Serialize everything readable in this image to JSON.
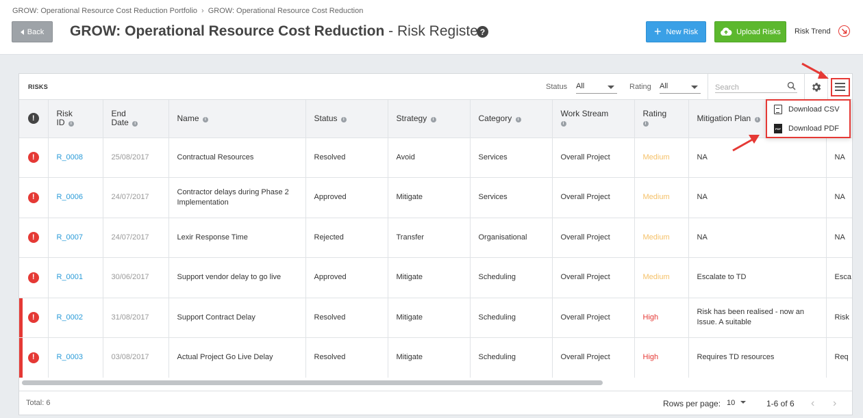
{
  "breadcrumb": [
    "GROW: Operational Resource Cost Reduction Portfolio",
    "GROW: Operational Resource Cost Reduction"
  ],
  "header": {
    "back_label": "Back",
    "title_bold": "GROW: Operational Resource Cost Reduction",
    "title_rest": " - Risk Register",
    "help": "?",
    "new_risk_label": "New Risk",
    "upload_risks_label": "Upload Risks",
    "risk_trend_label": "Risk Trend"
  },
  "toolbar": {
    "section_label": "RISKS",
    "status_label": "Status",
    "status_value": "All",
    "rating_label": "Rating",
    "rating_value": "All",
    "search_placeholder": "Search"
  },
  "dropdown": {
    "csv_label": "Download CSV",
    "pdf_label": "Download PDF",
    "pdf_icon_text": "PDF"
  },
  "table": {
    "headers": {
      "risk_id_1": "Risk",
      "risk_id_2": "ID",
      "end_date_1": "End",
      "end_date_2": "Date",
      "name": "Name",
      "status": "Status",
      "strategy": "Strategy",
      "category": "Category",
      "work_stream": "Work Stream",
      "rating": "Rating",
      "mitigation_plan": "Mitigation Plan"
    },
    "rows": [
      {
        "id": "R_0008",
        "end_date": "25/08/2017",
        "name": "Contractual Resources",
        "status": "Resolved",
        "strategy": "Avoid",
        "category": "Services",
        "work_stream": "Overall Project",
        "rating": "Medium",
        "mitigation": "NA",
        "extra": "NA",
        "flagged": false
      },
      {
        "id": "R_0006",
        "end_date": "24/07/2017",
        "name": "Contractor delays during Phase 2 Implementation",
        "status": "Approved",
        "strategy": "Mitigate",
        "category": "Services",
        "work_stream": "Overall Project",
        "rating": "Medium",
        "mitigation": "NA",
        "extra": "NA",
        "flagged": false
      },
      {
        "id": "R_0007",
        "end_date": "24/07/2017",
        "name": "Lexir Response Time",
        "status": "Rejected",
        "strategy": "Transfer",
        "category": "Organisational",
        "work_stream": "Overall Project",
        "rating": "Medium",
        "mitigation": "NA",
        "extra": "NA",
        "flagged": false
      },
      {
        "id": "R_0001",
        "end_date": "30/06/2017",
        "name": "Support vendor delay to go live",
        "status": "Approved",
        "strategy": "Mitigate",
        "category": "Scheduling",
        "work_stream": "Overall Project",
        "rating": "Medium",
        "mitigation": "Escalate to TD",
        "extra": "Esca",
        "flagged": false
      },
      {
        "id": "R_0002",
        "end_date": "31/08/2017",
        "name": "Support Contract Delay",
        "status": "Resolved",
        "strategy": "Mitigate",
        "category": "Scheduling",
        "work_stream": "Overall Project",
        "rating": "High",
        "mitigation": "Risk has been realised - now an Issue. A suitable",
        "extra": "Risk Issu",
        "flagged": true
      },
      {
        "id": "R_0003",
        "end_date": "03/08/2017",
        "name": "Actual Project Go Live Delay",
        "status": "Resolved",
        "strategy": "Mitigate",
        "category": "Scheduling",
        "work_stream": "Overall Project",
        "rating": "High",
        "mitigation": "Requires TD resources",
        "extra": "Req",
        "flagged": true
      }
    ]
  },
  "footer": {
    "total": "Total: 6",
    "rows_per_page_label": "Rows per page:",
    "rows_per_page_value": "10",
    "range": "1-6 of 6"
  },
  "colors": {
    "primary_blue": "#3aa0e6",
    "upload_green": "#5cb82e",
    "alert_red": "#e53935",
    "rating_medium": "#f5c168",
    "rating_high": "#e53935",
    "link_blue": "#2a9bd8"
  }
}
